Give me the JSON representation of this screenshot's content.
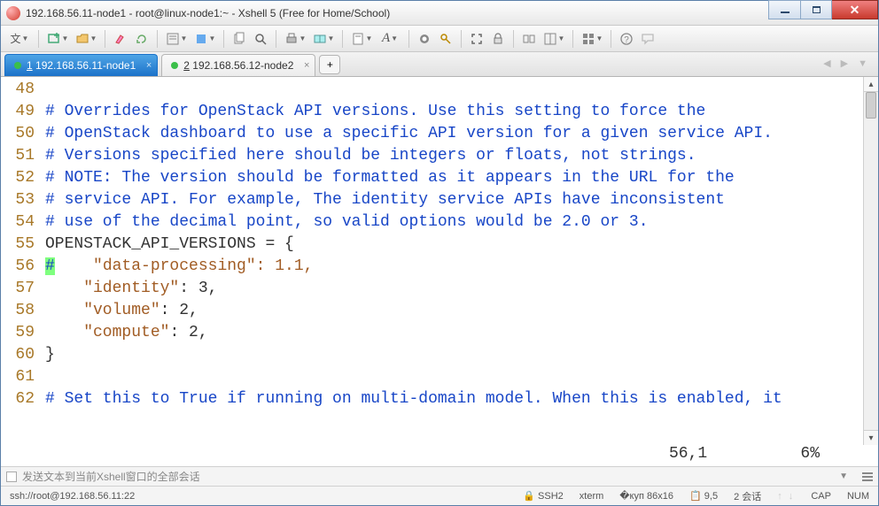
{
  "window": {
    "title": "192.168.56.11-node1 - root@linux-node1:~ - Xshell 5 (Free for Home/School)"
  },
  "tabs": [
    {
      "label": "1 192.168.56.11-node1",
      "active": true
    },
    {
      "label": "2 192.168.56.12-node2",
      "active": false
    }
  ],
  "toolbar_text_btn": "文",
  "editor": {
    "lines": [
      {
        "num": 48,
        "kind": "blank"
      },
      {
        "num": 49,
        "kind": "comment",
        "text": "# Overrides for OpenStack API versions. Use this setting to force the"
      },
      {
        "num": 50,
        "kind": "comment",
        "text": "# OpenStack dashboard to use a specific API version for a given service API."
      },
      {
        "num": 51,
        "kind": "comment",
        "text": "# Versions specified here should be integers or floats, not strings."
      },
      {
        "num": 52,
        "kind": "comment",
        "text": "# NOTE: The version should be formatted as it appears in the URL for the"
      },
      {
        "num": 53,
        "kind": "comment",
        "text": "# service API. For example, The identity service APIs have inconsistent"
      },
      {
        "num": 54,
        "kind": "comment",
        "text": "# use of the decimal point, so valid options would be 2.0 or 3."
      },
      {
        "num": 55,
        "kind": "code_plain",
        "text": "OPENSTACK_API_VERSIONS = {"
      },
      {
        "num": 56,
        "kind": "code_hl",
        "hl": "#",
        "rest": "    \"data-processing\": 1.1,"
      },
      {
        "num": 57,
        "kind": "code_kv",
        "key": "    \"identity\"",
        "val": ": 3,"
      },
      {
        "num": 58,
        "kind": "code_kv",
        "key": "    \"volume\"",
        "val": ": 2,"
      },
      {
        "num": 59,
        "kind": "code_kv",
        "key": "    \"compute\"",
        "val": ": 2,"
      },
      {
        "num": 60,
        "kind": "code_plain",
        "text": "}"
      },
      {
        "num": 61,
        "kind": "blank"
      },
      {
        "num": 62,
        "kind": "comment",
        "text": "# Set this to True if running on multi-domain model. When this is enabled, it"
      }
    ],
    "vim_position": "56,1",
    "vim_percent": "6%"
  },
  "broadcast_placeholder": "发送文本到当前Xshell窗口的全部会话",
  "statusbar": {
    "conn": "ssh://root@192.168.56.11:22",
    "proto": "SSH2",
    "term": "xterm",
    "size": "86x16",
    "cursor": "9,5",
    "sessions": "2 会话",
    "caps": "CAP",
    "num": "NUM"
  },
  "icons": {
    "lock": "🔒",
    "resize": "�订"
  }
}
